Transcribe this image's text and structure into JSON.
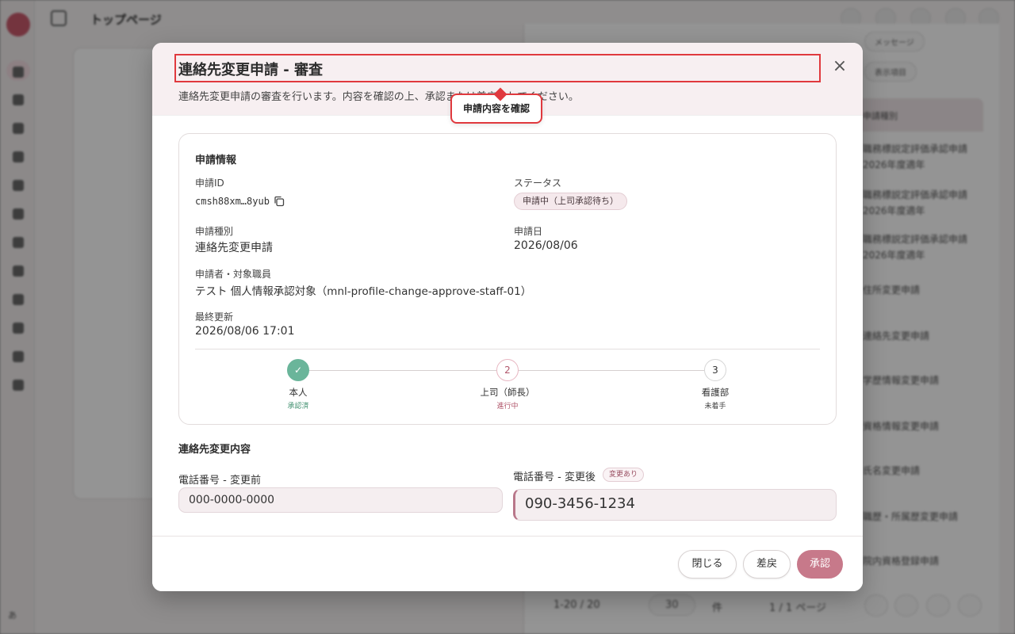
{
  "background": {
    "page_title": "トップページ",
    "sidebar_avatar": "あ",
    "table_header": "申請種別",
    "table_rows": [
      "職務標説定評価承認申請 2026年度適年",
      "職務標説定評価承認申請 2026年度適年",
      "職務標説定評価承認申請 2026年度適年",
      "住所変更申請",
      "連絡先変更申請",
      "学歴情報変更申請",
      "資格情報変更申請",
      "氏名変更申請",
      "職歴・所属歴変更申請",
      "院内資格登録申請"
    ],
    "pagination_count": "1-20 / 20",
    "per_page": "30",
    "per_page_unit": "件",
    "page_indicator": "1 / 1 ページ",
    "pill_1": "メッセージ",
    "pill_2": "表示項目"
  },
  "modal": {
    "title": "連絡先変更申請 - 審査",
    "description": "連絡先変更申請の審査を行います。内容を確認の上、承認または差戻ししてください。",
    "close_icon": "close-icon",
    "tooltip": "申請内容を確認"
  },
  "info": {
    "section_title": "申請情報",
    "id_label": "申請ID",
    "id_value": "cmsh88xm…8yub",
    "status_label": "ステータス",
    "status_value": "申請中（上司承認待ち）",
    "type_label": "申請種別",
    "type_value": "連絡先変更申請",
    "date_label": "申請日",
    "date_value": "2026/08/06",
    "applicant_label": "申請者・対象職員",
    "applicant_value": "テスト 個人情報承認対象（mnl-profile-change-approve-staff-01）",
    "updated_label": "最終更新",
    "updated_value": "2026/08/06 17:01"
  },
  "steps": [
    {
      "symbol": "✓",
      "label": "本人",
      "status": "承認済",
      "state": "done",
      "color": "#3f8f6e"
    },
    {
      "symbol": "2",
      "label": "上司（師長）",
      "status": "進行中",
      "state": "active",
      "color": "#b1566b"
    },
    {
      "symbol": "3",
      "label": "看護部",
      "status": "未着手",
      "state": "todo",
      "color": "#444444"
    }
  ],
  "change": {
    "section_title": "連絡先変更内容",
    "before_label": "電話番号 - 変更前",
    "before_value": "000-0000-0000",
    "after_label": "電話番号 - 変更後",
    "changed_badge": "変更あり",
    "after_value": "090-3456-1234"
  },
  "footer": {
    "close_label": "閉じる",
    "return_label": "差戻",
    "approve_label": "承認"
  },
  "colors": {
    "accent": "#c7798a",
    "highlight": "#e0393e",
    "done": "#6ab59a"
  }
}
